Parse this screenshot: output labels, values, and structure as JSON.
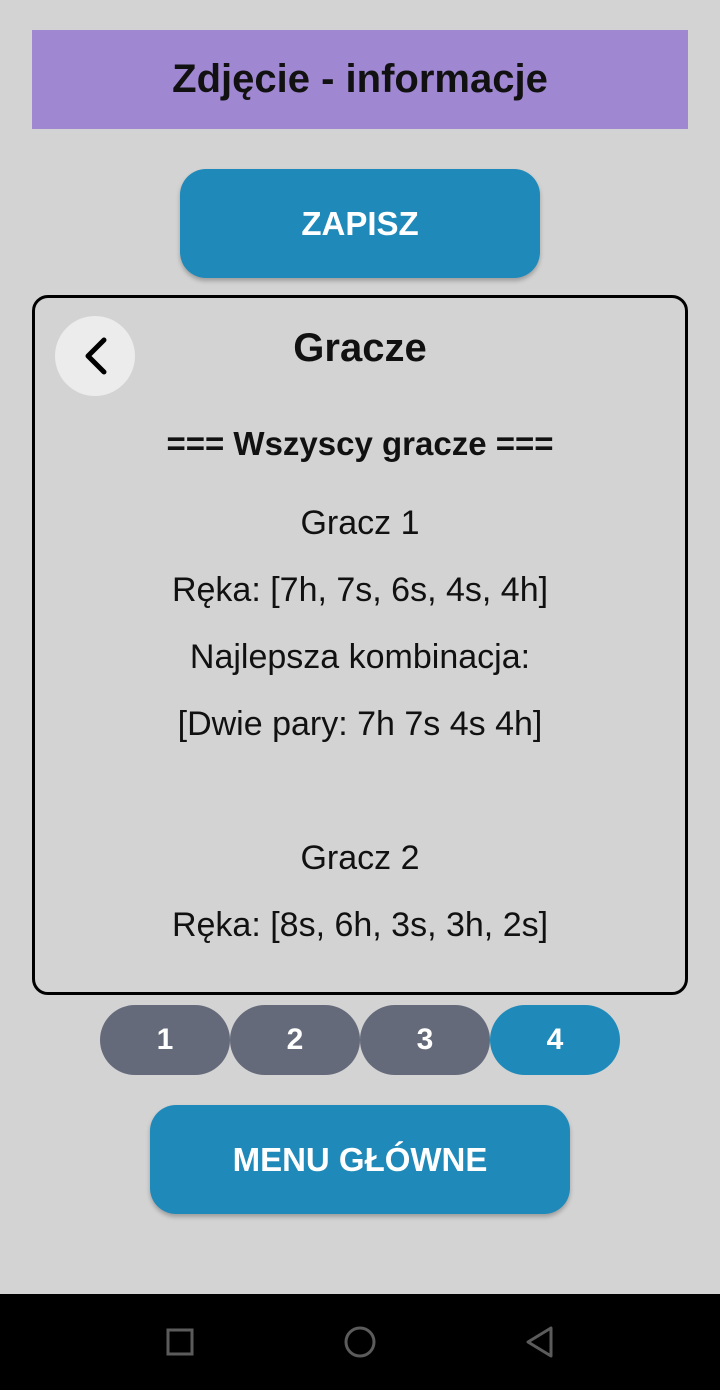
{
  "header": {
    "title": "Zdjęcie - informacje"
  },
  "save_button": {
    "label": "ZAPISZ"
  },
  "card": {
    "title": "Gracze",
    "heading": "=== Wszyscy gracze ===",
    "players": [
      {
        "name": "Gracz 1",
        "hand": "Ręka: [7h, 7s, 6s, 4s, 4h]",
        "best_label": "Najlepsza kombinacja:",
        "best_value": "[Dwie pary: 7h 7s 4s 4h]"
      },
      {
        "name": "Gracz 2",
        "hand": "Ręka: [8s, 6h, 3s, 3h, 2s]"
      }
    ]
  },
  "pager": {
    "pages": [
      "1",
      "2",
      "3",
      "4"
    ],
    "active": "4"
  },
  "menu_button": {
    "label": "MENU GŁÓWNE"
  },
  "colors": {
    "header_bg": "#a087d2",
    "accent": "#1f8ab9",
    "inactive_page": "#646a7a",
    "background": "#d3d3d3"
  },
  "nav_icons": [
    "square-recent-icon",
    "circle-home-icon",
    "triangle-back-icon"
  ]
}
